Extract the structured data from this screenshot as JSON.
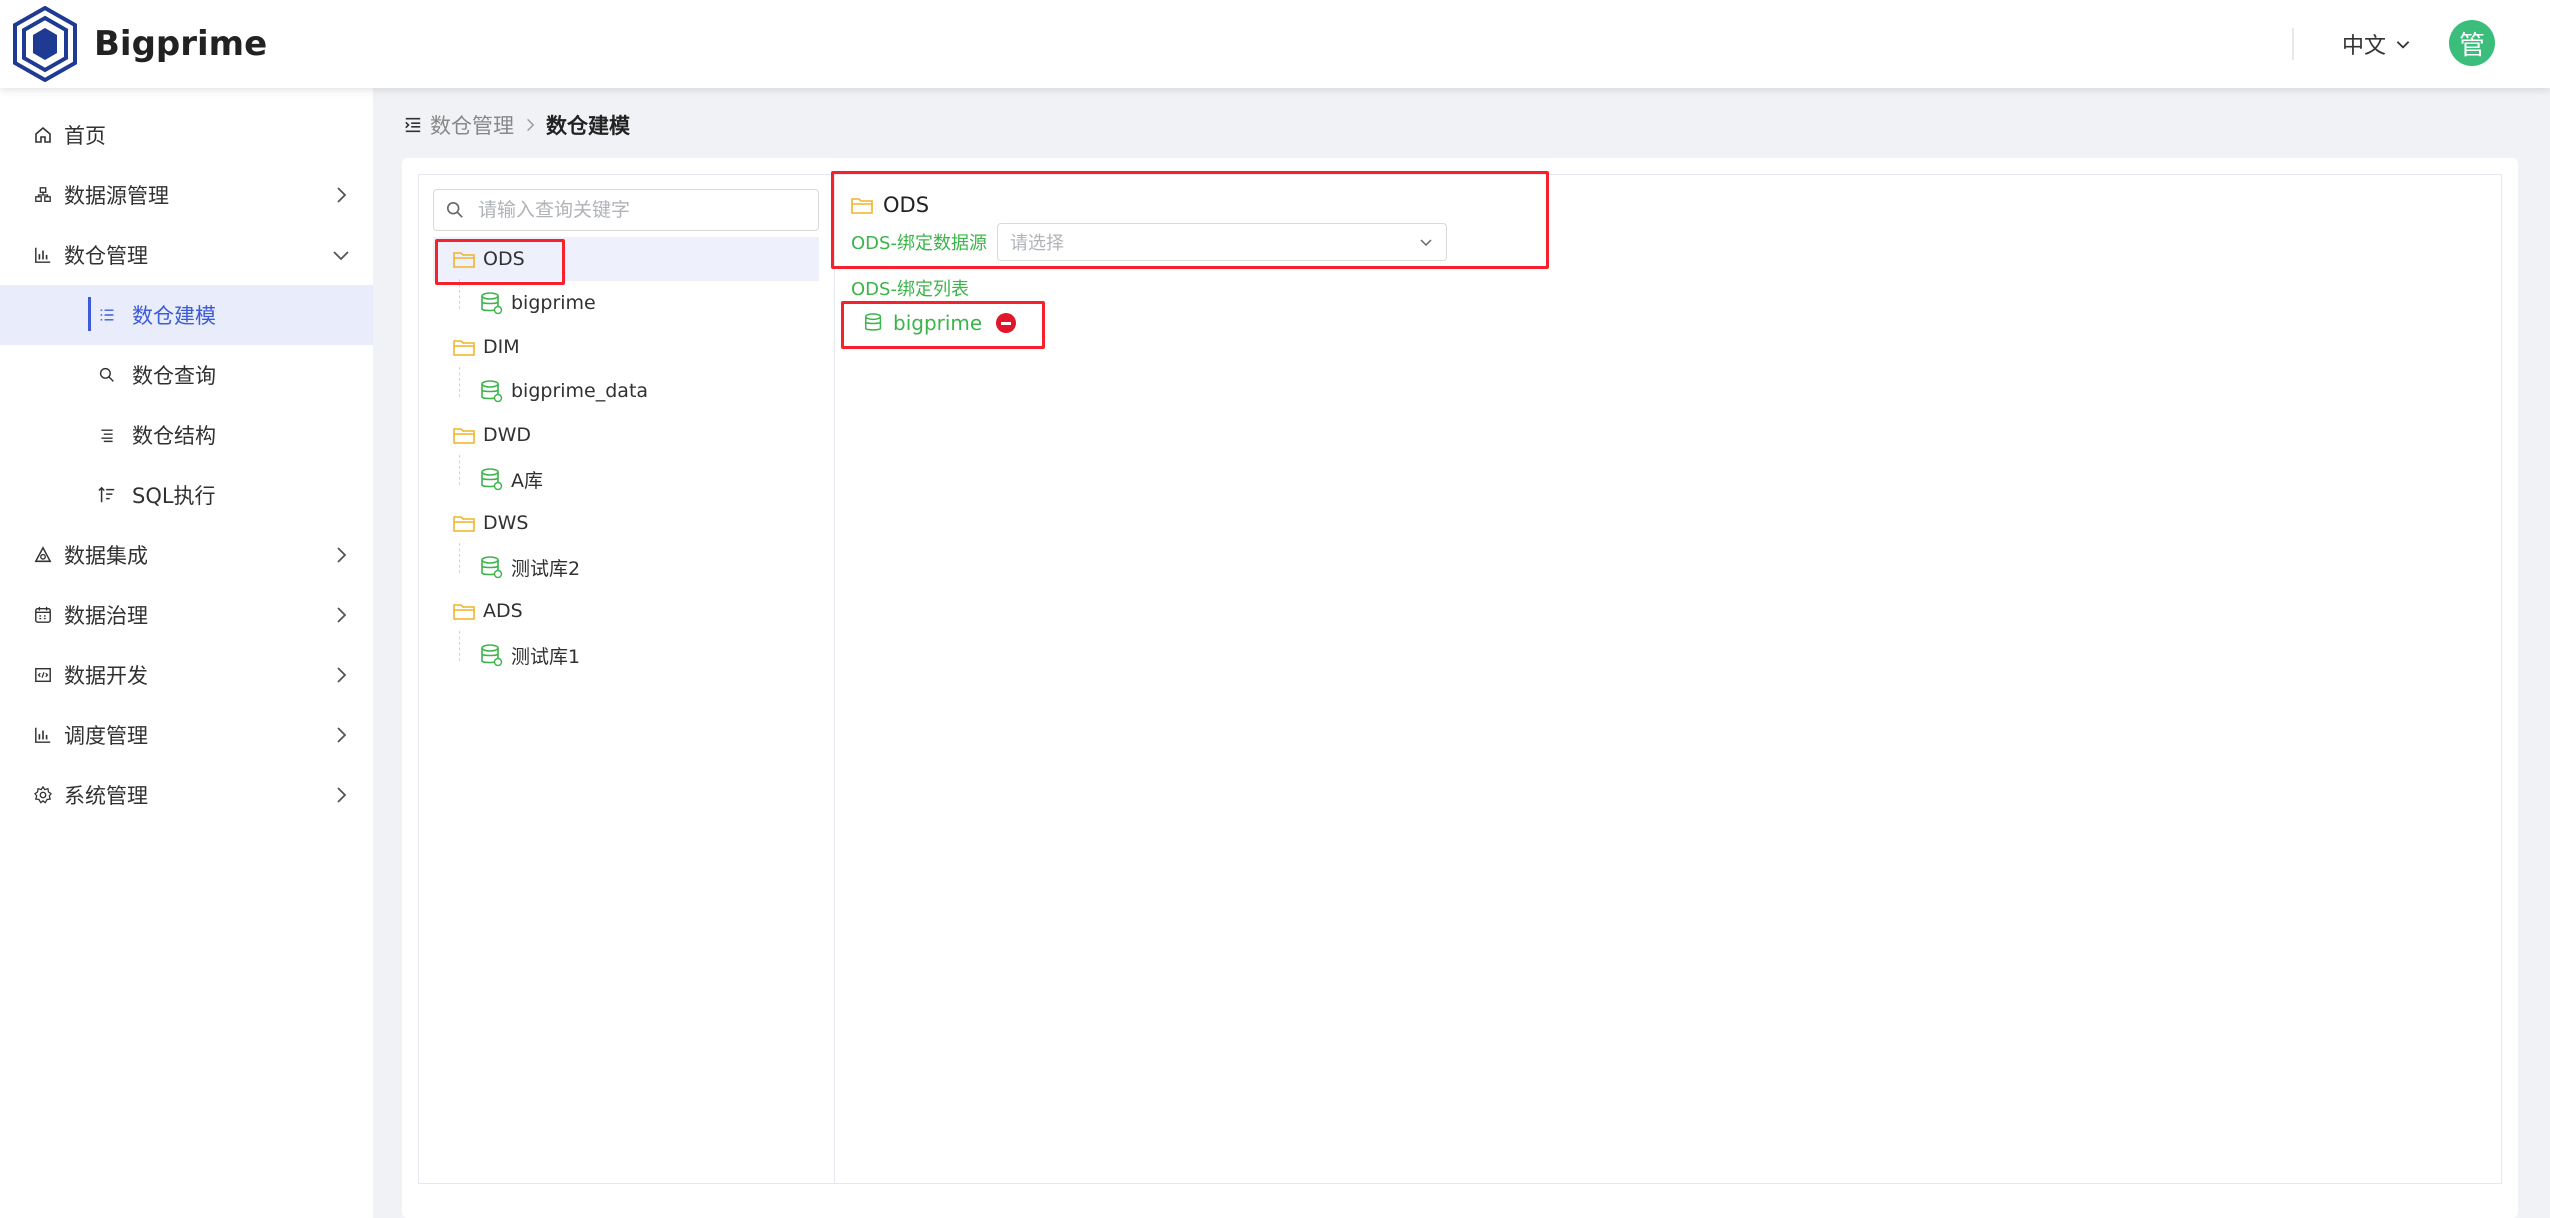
{
  "app": {
    "brand": "Bigprime"
  },
  "header": {
    "language": "中文",
    "avatar_text": "管"
  },
  "sidebar": {
    "items": [
      {
        "label": "首页",
        "icon": "home-icon"
      },
      {
        "label": "数据源管理",
        "icon": "datasource-icon"
      },
      {
        "label": "数仓管理",
        "icon": "bar-chart-icon"
      },
      {
        "label": "数仓建模",
        "icon": "list-icon"
      },
      {
        "label": "数仓查询",
        "icon": "search-icon"
      },
      {
        "label": "数仓结构",
        "icon": "structure-icon"
      },
      {
        "label": "SQL执行",
        "icon": "sql-icon"
      },
      {
        "label": "数据集成",
        "icon": "integration-icon"
      },
      {
        "label": "数据治理",
        "icon": "calendar-icon"
      },
      {
        "label": "数据开发",
        "icon": "code-icon"
      },
      {
        "label": "调度管理",
        "icon": "bar-chart-icon"
      },
      {
        "label": "系统管理",
        "icon": "gear-icon"
      }
    ]
  },
  "breadcrumb": {
    "parent": "数仓管理",
    "current": "数仓建模"
  },
  "tree": {
    "search_placeholder": "请输入查询关键字",
    "nodes": [
      {
        "folder": "ODS",
        "child": "bigprime"
      },
      {
        "folder": "DIM",
        "child": "bigprime_data"
      },
      {
        "folder": "DWD",
        "child": "A库"
      },
      {
        "folder": "DWS",
        "child": "测试库2"
      },
      {
        "folder": "ADS",
        "child": "测试库1"
      }
    ]
  },
  "detail": {
    "title": "ODS",
    "bind_source_label": "ODS-绑定数据源",
    "bind_source_placeholder": "请选择",
    "bind_list_label": "ODS-绑定列表",
    "bound_items": [
      "bigprime"
    ]
  },
  "colors": {
    "accent": "#3d5bd9",
    "green": "#3bb54a",
    "folder": "#f0b429",
    "highlight": "#f5222d",
    "avatar": "#3bbd7c"
  }
}
